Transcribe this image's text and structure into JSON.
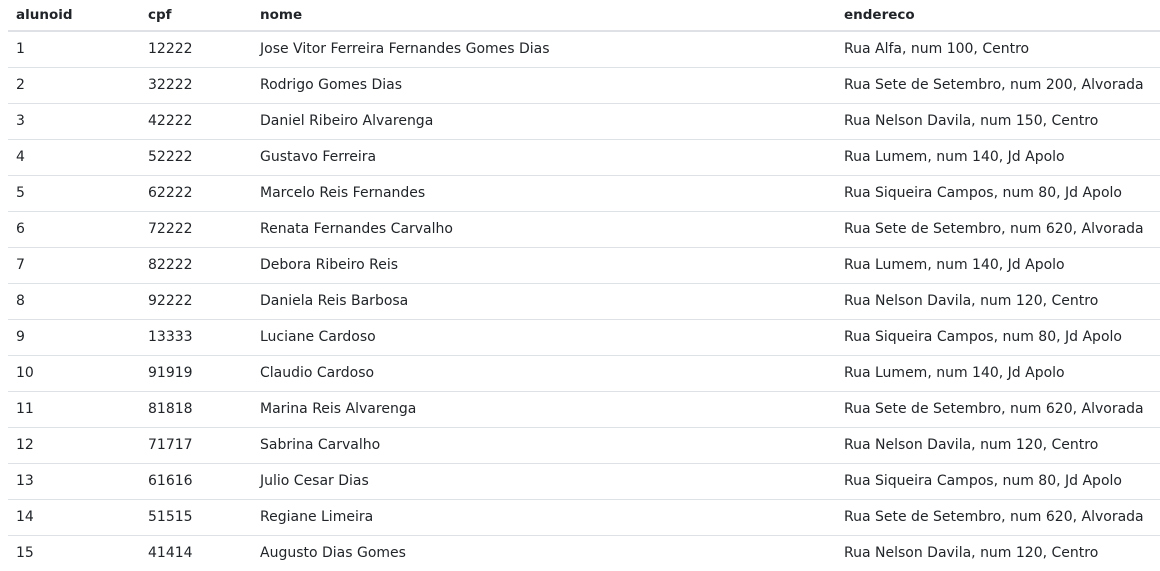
{
  "table": {
    "columns": [
      "alunoid",
      "cpf",
      "nome",
      "endereco"
    ],
    "rows": [
      [
        "1",
        "12222",
        "Jose Vitor Ferreira Fernandes Gomes Dias",
        "Rua Alfa, num 100, Centro"
      ],
      [
        "2",
        "32222",
        "Rodrigo Gomes Dias",
        "Rua Sete de Setembro, num 200, Alvorada"
      ],
      [
        "3",
        "42222",
        "Daniel Ribeiro Alvarenga",
        "Rua Nelson Davila, num 150, Centro"
      ],
      [
        "4",
        "52222",
        "Gustavo Ferreira",
        "Rua Lumem, num 140, Jd Apolo"
      ],
      [
        "5",
        "62222",
        "Marcelo Reis Fernandes",
        "Rua Siqueira Campos, num 80, Jd Apolo"
      ],
      [
        "6",
        "72222",
        "Renata Fernandes Carvalho",
        "Rua Sete de Setembro, num 620, Alvorada"
      ],
      [
        "7",
        "82222",
        "Debora Ribeiro Reis",
        "Rua Lumem, num 140, Jd Apolo"
      ],
      [
        "8",
        "92222",
        "Daniela Reis Barbosa",
        "Rua Nelson Davila, num 120, Centro"
      ],
      [
        "9",
        "13333",
        "Luciane Cardoso",
        "Rua Siqueira Campos, num 80, Jd Apolo"
      ],
      [
        "10",
        "91919",
        "Claudio Cardoso",
        "Rua Lumem, num 140, Jd Apolo"
      ],
      [
        "11",
        "81818",
        "Marina Reis Alvarenga",
        "Rua Sete de Setembro, num 620, Alvorada"
      ],
      [
        "12",
        "71717",
        "Sabrina Carvalho",
        "Rua Nelson Davila, num 120, Centro"
      ],
      [
        "13",
        "61616",
        "Julio Cesar Dias",
        "Rua Siqueira Campos, num 80, Jd Apolo"
      ],
      [
        "14",
        "51515",
        "Regiane Limeira",
        "Rua Sete de Setembro, num 620, Alvorada"
      ],
      [
        "15",
        "41414",
        "Augusto Dias Gomes",
        "Rua Nelson Davila, num 120, Centro"
      ]
    ]
  },
  "colors": {
    "text": "#212529",
    "border": "#dee2e6",
    "background": "#ffffff"
  }
}
